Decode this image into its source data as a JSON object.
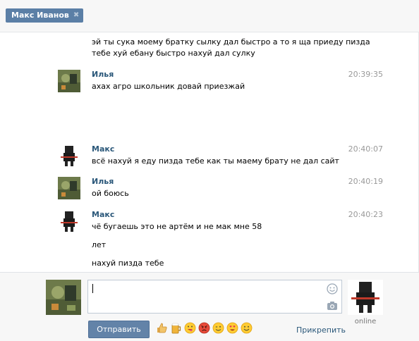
{
  "tab": {
    "title": "Макс Иванов",
    "close_glyph": "✖"
  },
  "messages": [
    {
      "lines": [
        "эй ты сука моему братку сылку дал быстро а то я ща приеду пизда",
        "тебе хуй ебану быстро нахуй дал сулку"
      ]
    },
    {
      "author": "Илья",
      "time": "20:39:35",
      "lines": [
        "ахах агро школьник довай приезжай"
      ]
    },
    {
      "author": "Макс",
      "time": "20:40:07",
      "lines": [
        "всё нахуй я еду пизда тебе как ты маему брату не дал сайт"
      ]
    },
    {
      "author": "Илья",
      "time": "20:40:19",
      "lines": [
        "ой боюсь"
      ]
    },
    {
      "author": "Макс",
      "time": "20:40:23",
      "lines": [
        "чё бугаешь это не артём и не мак мне 58",
        "лет",
        "нахуй пизда тебе"
      ]
    }
  ],
  "compose": {
    "input_value": "",
    "send_label": "Отправить",
    "attach_label": "Прикрепить",
    "peer_status": "online",
    "emoji": [
      "thumbs-up",
      "beer",
      "yum-face",
      "angry-face",
      "wink-face",
      "heart-eyes-face",
      "smile-face"
    ]
  },
  "colors": {
    "accent": "#5b7fa6",
    "name_link": "#2b587a",
    "send_button": "#6383a8"
  }
}
